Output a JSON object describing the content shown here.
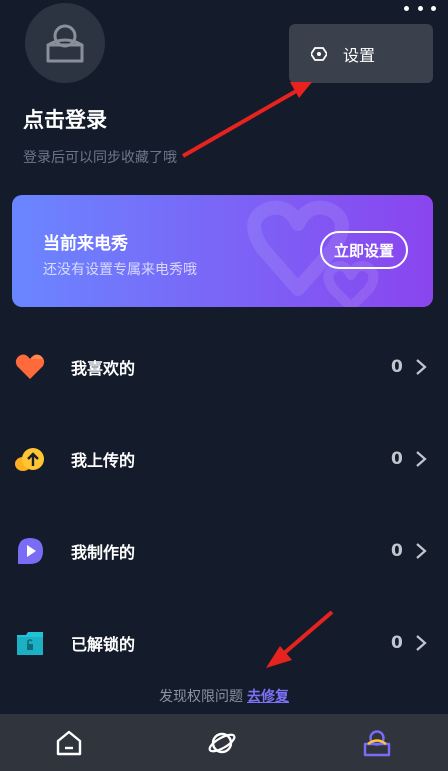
{
  "header": {
    "avatar_icon": "user-avatar-icon",
    "more_icon": "more-dots-icon"
  },
  "popup_menu": {
    "items": [
      {
        "icon": "settings-gear-icon",
        "label": "设置"
      }
    ]
  },
  "login": {
    "title": "点击登录",
    "subtitle": "登录后可以同步收藏了哦"
  },
  "banner": {
    "title": "当前来电秀",
    "subtitle": "还没有设置专属来电秀哦",
    "button_label": "立即设置",
    "gradient": [
      "#6a86ff",
      "#8a45ee"
    ]
  },
  "list": [
    {
      "label": "我喜欢的",
      "count": "0",
      "icon": "heart-icon",
      "color": "#ff6a3d"
    },
    {
      "label": "我上传的",
      "count": "0",
      "icon": "cloud-upload-icon",
      "color": "#ffb020"
    },
    {
      "label": "我制作的",
      "count": "0",
      "icon": "play-chat-icon",
      "color": "#7b6cf6"
    },
    {
      "label": "已解锁的",
      "count": "0",
      "icon": "unlocked-folder-icon",
      "color": "#21c3d6"
    }
  ],
  "notice": {
    "text": "发现权限问题",
    "link": "去修复"
  },
  "tabbar": {
    "tabs": [
      {
        "icon": "home-icon",
        "active": false
      },
      {
        "icon": "planet-icon",
        "active": false
      },
      {
        "icon": "profile-icon",
        "active": true
      }
    ],
    "active_color": "#7b6cf6"
  }
}
